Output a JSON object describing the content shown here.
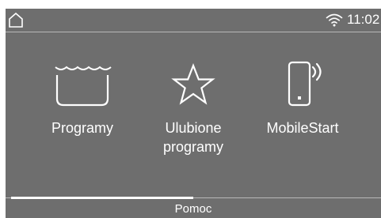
{
  "status_bar": {
    "home_icon": "home-icon",
    "wifi_icon": "wifi-icon",
    "time": "11:02"
  },
  "tiles": [
    {
      "label": "Programy",
      "icon": "washing-tub-icon"
    },
    {
      "label": "Ulubione programy",
      "icon": "star-icon"
    },
    {
      "label": "MobileStart",
      "icon": "smartphone-signal-icon"
    }
  ],
  "help": {
    "label": "Pomoc",
    "progress_fraction": 0.5
  },
  "colors": {
    "screen_background": "#6e6e6e",
    "foreground": "#ffffff"
  }
}
